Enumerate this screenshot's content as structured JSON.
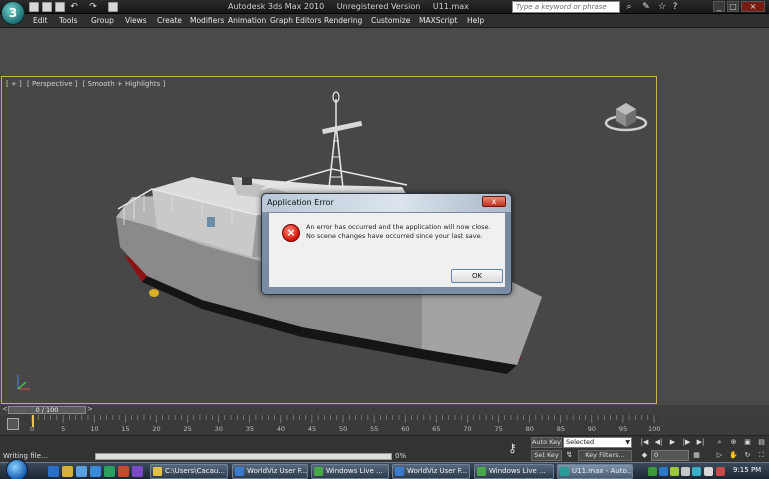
{
  "window": {
    "app_name": "Autodesk 3ds Max  2010",
    "edition": "Unregistered Version",
    "file": "U11.max",
    "search_placeholder": "Type a keyword or phrase"
  },
  "menu": [
    "Edit",
    "Tools",
    "Group",
    "Views",
    "Create",
    "Modifiers",
    "Animation",
    "Graph Editors",
    "Rendering",
    "Customize",
    "MAXScript",
    "Help"
  ],
  "viewport": {
    "label_parts": [
      "[ + ]",
      "[ Perspective ]",
      "[ Smooth + Highlights ]"
    ]
  },
  "dialog": {
    "title": "Application Error",
    "close_label": "x",
    "message_line1": "An error has occurred and the application will now close.",
    "message_line2": "No scene changes have occurred since your last save.",
    "ok_label": "OK"
  },
  "timeline": {
    "frame_display": "0 / 100",
    "prev_arrow": "<",
    "next_arrow": ">",
    "ticks": [
      "0",
      "5",
      "10",
      "15",
      "20",
      "25",
      "30",
      "35",
      "40",
      "45",
      "50",
      "55",
      "60",
      "65",
      "70",
      "75",
      "80",
      "85",
      "90",
      "95",
      "100"
    ]
  },
  "status": {
    "text": "Writing file...",
    "progress_label": "0%",
    "progress_value": 0
  },
  "anim_controls": {
    "auto_key": "Auto Key",
    "set_key": "Set Key",
    "selected_option": "Selected",
    "key_filters": "Key Filters...",
    "frame_value": "0"
  },
  "taskbar": {
    "items": [
      {
        "label": "C:\\Users\\Cacau...",
        "color": "#e2c04a"
      },
      {
        "label": "WorldViz User F...",
        "color": "#3a7ad0"
      },
      {
        "label": "Windows Live ...",
        "color": "#4aa84a"
      },
      {
        "label": "WorldViz User F...",
        "color": "#3a7ad0"
      },
      {
        "label": "Windows Live ...",
        "color": "#4aa84a"
      },
      {
        "label": "U11.max - Auto...",
        "color": "#2a9c9a"
      }
    ],
    "clock": "9:15 PM"
  }
}
